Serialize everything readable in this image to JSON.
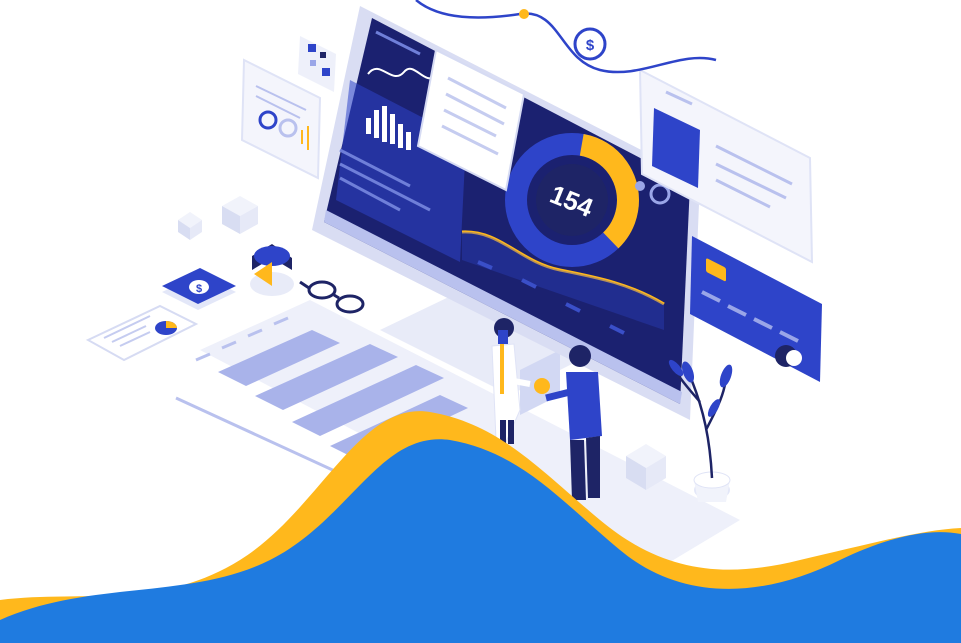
{
  "illustration": {
    "gauge_value": "154",
    "gauge_fill_fraction": 0.35,
    "currency_symbol": "$"
  },
  "colors": {
    "navy": "#1e2466",
    "screen_dark": "#1b2170",
    "royal_blue": "#2e44c9",
    "bright_blue": "#1f7be0",
    "periwinkle": "#9aa6e8",
    "light_lavender": "#dfe3f6",
    "amber": "#ffb81c",
    "white": "#ffffff"
  }
}
